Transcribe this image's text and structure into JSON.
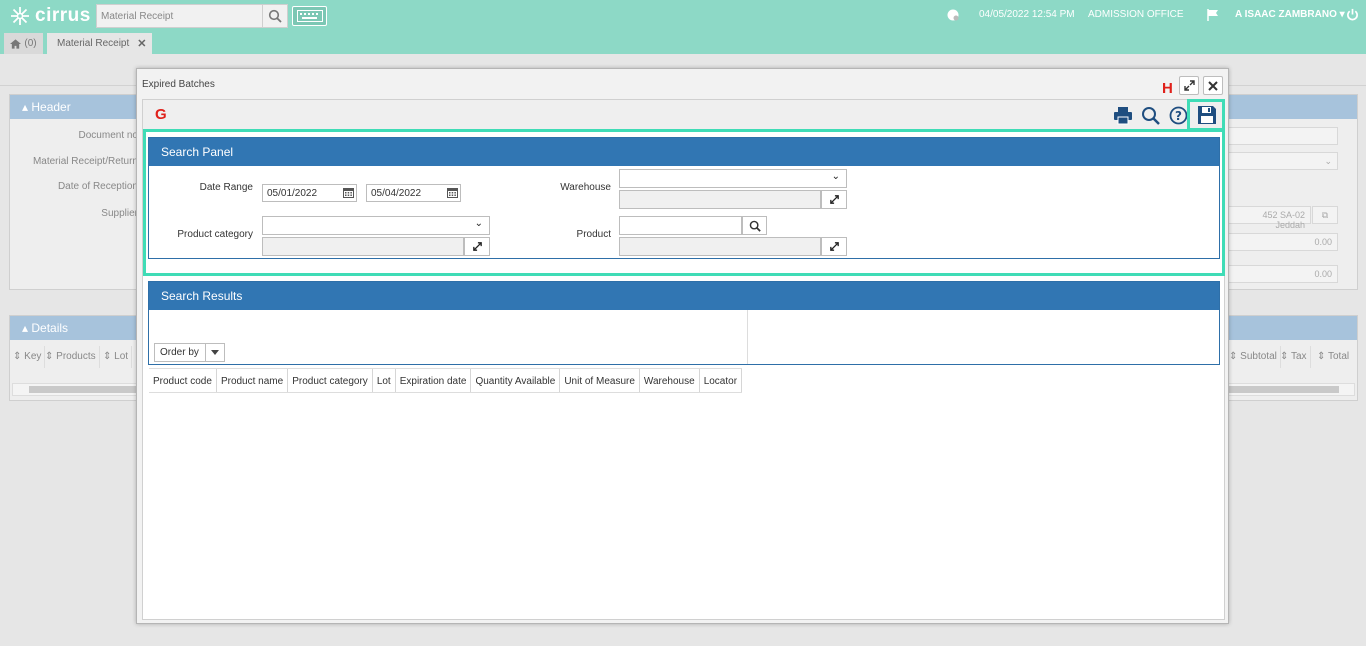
{
  "topbar": {
    "logo_text": "cirrus",
    "search_placeholder": "Material Receipt",
    "datetime": "04/05/2022 12:54 PM",
    "office": "ADMISSION OFFICE",
    "user": "A ISAAC ZAMBRANO"
  },
  "tabs": {
    "home_count": "(0)",
    "active_tab": "Material Receipt"
  },
  "background": {
    "header_title": "Header",
    "labels": [
      "Document no",
      "Material Receipt/Return",
      "Date of Reception",
      "Supplier"
    ],
    "supplier_value": "452 SA-02 Jeddah",
    "amount1": "0.00",
    "amount2": "0.00",
    "details_title": "Details",
    "detail_columns": [
      "Key",
      "Products",
      "Lot"
    ],
    "detail_columns_right": [
      "Subtotal",
      "Tax",
      "Total"
    ]
  },
  "modal": {
    "title": "Expired Batches",
    "marker_g": "G",
    "marker_h": "H",
    "search_panel": {
      "title": "Search Panel",
      "date_range_label": "Date Range",
      "date_from": "05/01/2022",
      "date_to": "05/04/2022",
      "warehouse_label": "Warehouse",
      "product_category_label": "Product category",
      "product_label": "Product"
    },
    "search_results": {
      "title": "Search Results",
      "order_by_label": "Order by",
      "columns": [
        "Product code",
        "Product name",
        "Product category",
        "Lot",
        "Expiration date",
        "Quantity Available",
        "Unit of Measure",
        "Warehouse",
        "Locator"
      ]
    }
  },
  "colors": {
    "topbar": "#8dd9c6",
    "section_header": "#3176b3",
    "highlight": "#3fdcb6",
    "marker": "#e0211b"
  }
}
